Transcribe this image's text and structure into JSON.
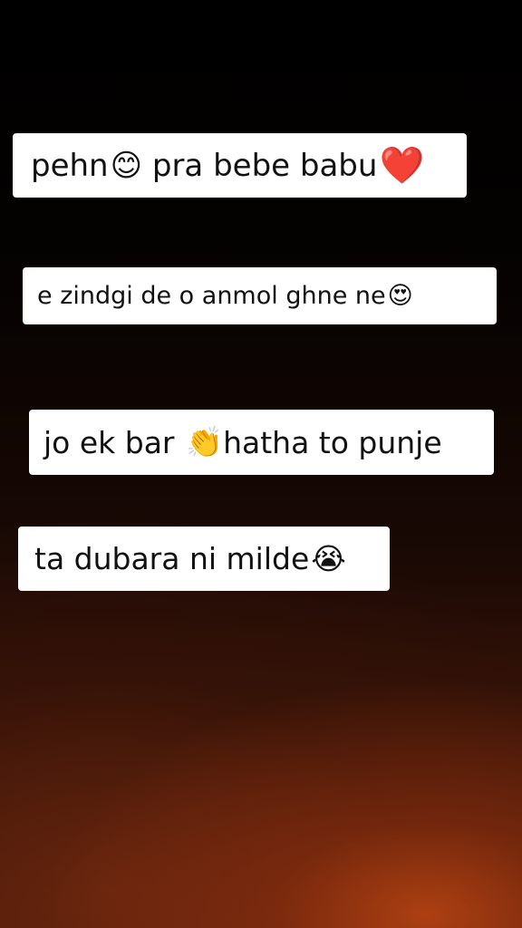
{
  "captions": [
    {
      "text_a": "pehn",
      "emoji_a": "😊",
      "text_b": " pra bebe babu",
      "emoji_b": "❤️"
    },
    {
      "text_a": "e zindgi de o anmol ghne ne",
      "emoji_a": "😍"
    },
    {
      "text_a": "jo ek bar ",
      "emoji_a": "👏",
      "text_b": "hatha to punje"
    },
    {
      "text_a": "ta dubara ni milde",
      "emoji_a": "😭"
    }
  ],
  "colors": {
    "caption_bg": "#ffffff",
    "caption_text": "#111111",
    "background_glow": "#be4614"
  },
  "icons": [
    "smiling-face-icon",
    "red-heart-icon",
    "heart-eyes-icon",
    "clapping-hands-icon",
    "crying-face-icon"
  ]
}
